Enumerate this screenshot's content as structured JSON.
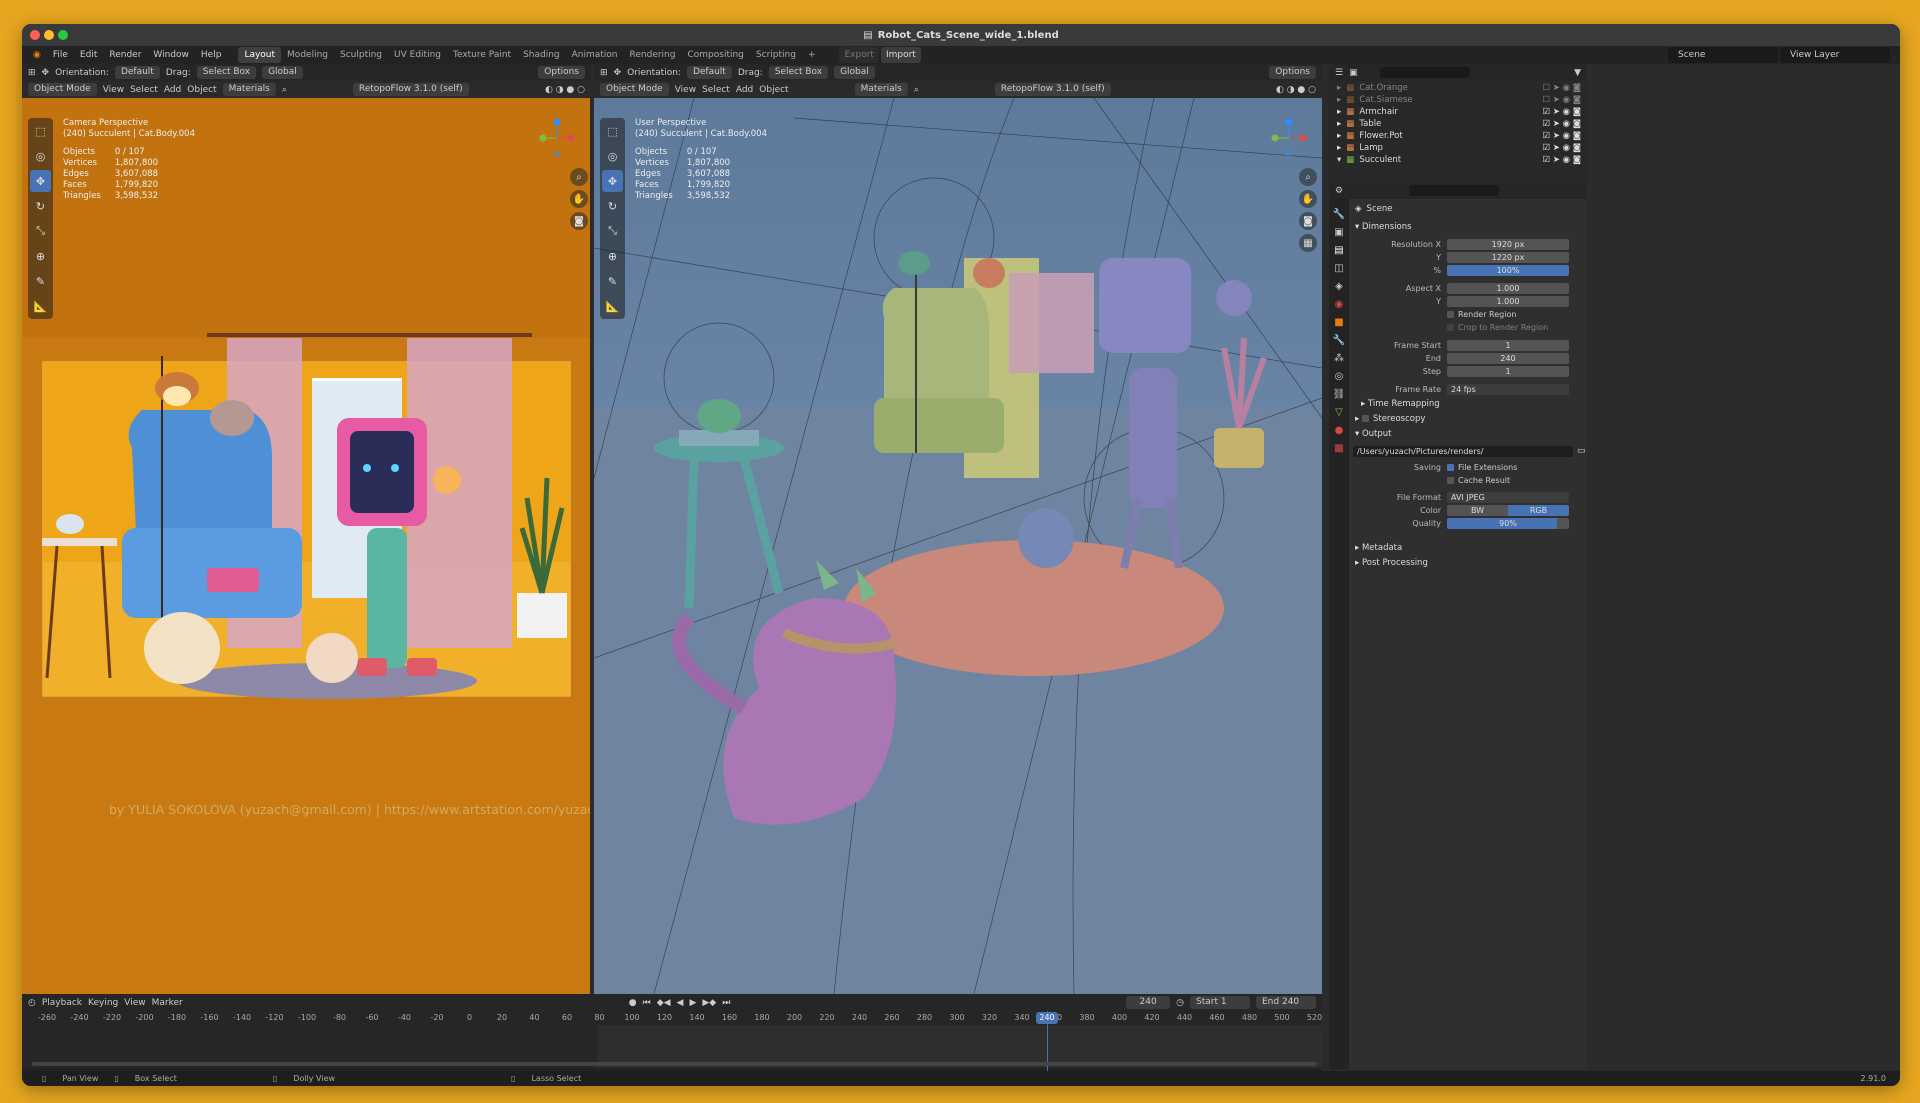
{
  "window": {
    "title": "Robot_Cats_Scene_wide_1.blend",
    "version": "2.91.0"
  },
  "menu": [
    "File",
    "Edit",
    "Render",
    "Window",
    "Help"
  ],
  "workspaces": [
    "Layout",
    "Modeling",
    "Sculpting",
    "UV Editing",
    "Texture Paint",
    "Shading",
    "Animation",
    "Rendering",
    "Compositing",
    "Scripting"
  ],
  "export_label": "Export",
  "import_label": "Import",
  "scene_field": "Scene",
  "view_layer_field": "View Layer",
  "left_viewport": {
    "orientation_label": "Orientation:",
    "orientation_value": "Default",
    "drag_label": "Drag:",
    "drag_value": "Select Box",
    "transform": "Global",
    "options": "Options",
    "mode": "Object Mode",
    "menus": [
      "View",
      "Select",
      "Add",
      "Object"
    ],
    "shading": "Materials",
    "addon": "RetopoFlow 3.1.0 (self)",
    "perspective": "Camera Perspective",
    "active": "(240) Succulent | Cat.Body.004",
    "stats": [
      [
        "Objects",
        "0 / 107"
      ],
      [
        "Vertices",
        "1,807,800"
      ],
      [
        "Edges",
        "3,607,088"
      ],
      [
        "Faces",
        "1,799,820"
      ],
      [
        "Triangles",
        "3,598,532"
      ]
    ],
    "credit": "by YULIA SOKOLOVA (yuzach@gmail.com)  |  https://www.artstation.com/yuzach"
  },
  "right_viewport": {
    "orientation_label": "Orientation:",
    "orientation_value": "Default",
    "drag_label": "Drag:",
    "drag_value": "Select Box",
    "transform": "Global",
    "options": "Options",
    "mode": "Object Mode",
    "menus": [
      "View",
      "Select",
      "Add",
      "Object"
    ],
    "shading": "Materials",
    "addon": "RetopoFlow 3.1.0 (self)",
    "perspective": "User Perspective",
    "active": "(240) Succulent | Cat.Body.004",
    "stats": [
      [
        "Objects",
        "0 / 107"
      ],
      [
        "Vertices",
        "1,807,800"
      ],
      [
        "Edges",
        "3,607,088"
      ],
      [
        "Faces",
        "1,799,820"
      ],
      [
        "Triangles",
        "3,598,532"
      ]
    ]
  },
  "outliner": [
    {
      "name": "Cat.Orange",
      "dim": true
    },
    {
      "name": "Cat.Siamese",
      "dim": true
    },
    {
      "name": "Armchair",
      "dim": false
    },
    {
      "name": "Table",
      "dim": false
    },
    {
      "name": "Flower.Pot",
      "dim": false
    },
    {
      "name": "Lamp",
      "dim": false
    },
    {
      "name": "Succulent",
      "dim": false
    }
  ],
  "properties": {
    "context": "Scene",
    "dimensions": {
      "title": "Dimensions",
      "res_x_label": "Resolution X",
      "res_x": "1920 px",
      "res_y_label": "Y",
      "res_y": "1220 px",
      "pct_label": "%",
      "pct": "100%",
      "aspect_x_label": "Aspect X",
      "aspect_x": "1.000",
      "aspect_y_label": "Y",
      "aspect_y": "1.000",
      "render_region": "Render Region",
      "crop": "Crop to Render Region",
      "frame_start_label": "Frame Start",
      "frame_start": "1",
      "end_label": "End",
      "end": "240",
      "step_label": "Step",
      "step": "1",
      "frame_rate_label": "Frame Rate",
      "frame_rate": "24 fps"
    },
    "time_remapping": "Time Remapping",
    "stereoscopy": "Stereoscopy",
    "output": {
      "title": "Output",
      "path": "/Users/yuzach/Pictures/renders/",
      "saving_label": "Saving",
      "file_ext": "File Extensions",
      "cache": "Cache Result",
      "format_label": "File Format",
      "format": "AVI JPEG",
      "color_label": "Color",
      "bw": "BW",
      "rgb": "RGB",
      "quality_label": "Quality",
      "quality": "90%"
    },
    "metadata": "Metadata",
    "post": "Post Processing"
  },
  "timeline": {
    "menus": [
      "Playback",
      "Keying",
      "View",
      "Marker"
    ],
    "current": "240",
    "start_label": "Start",
    "start": "1",
    "end_label": "End",
    "end": "240",
    "ticks": [
      "-260",
      "-240",
      "-220",
      "-200",
      "-180",
      "-160",
      "-140",
      "-120",
      "-100",
      "-80",
      "-60",
      "-40",
      "-20",
      "0",
      "20",
      "40",
      "60",
      "80",
      "100",
      "120",
      "140",
      "160",
      "180",
      "200",
      "220",
      "240",
      "260",
      "280",
      "300",
      "320",
      "340",
      "360",
      "380",
      "400",
      "420",
      "440",
      "460",
      "480",
      "500",
      "520"
    ]
  },
  "status": [
    "Pan View",
    "Box Select",
    "Dolly View",
    "Lasso Select"
  ]
}
